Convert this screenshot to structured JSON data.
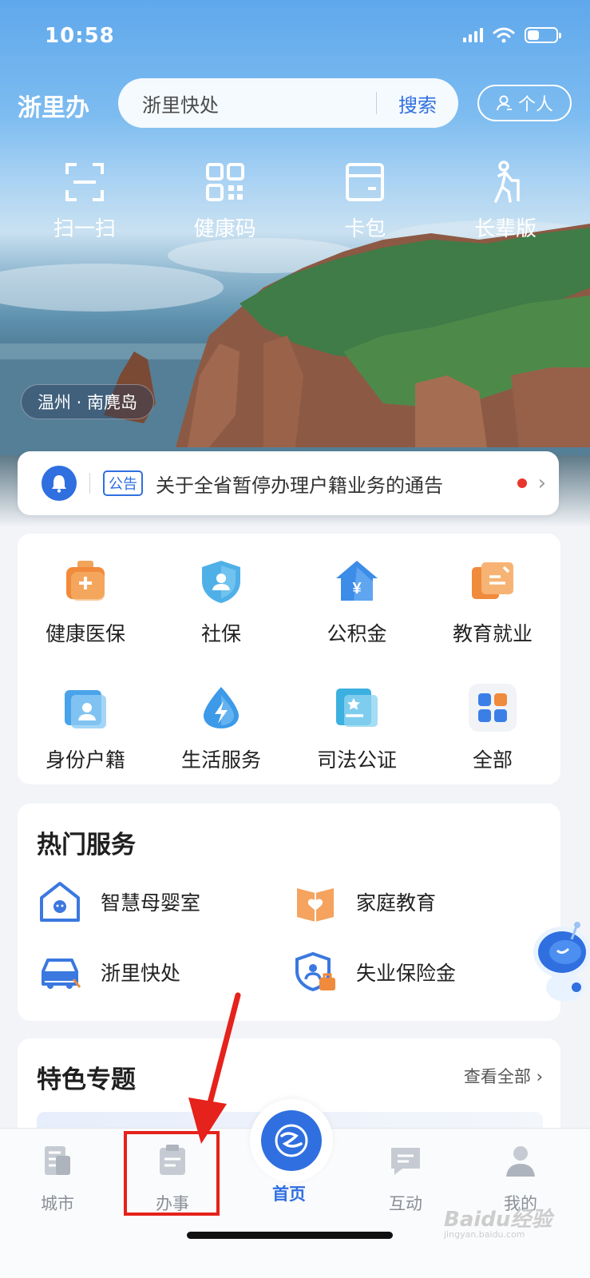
{
  "status": {
    "time": "10:58"
  },
  "header": {
    "brand": "浙里办",
    "search_placeholder": "浙里快处",
    "search_button": "搜索",
    "personal_label": "个人"
  },
  "quick_actions": [
    {
      "label": "扫一扫",
      "icon": "scan-icon"
    },
    {
      "label": "健康码",
      "icon": "qr-code-icon"
    },
    {
      "label": "卡包",
      "icon": "card-wallet-icon"
    },
    {
      "label": "长辈版",
      "icon": "elder-icon"
    }
  ],
  "location": "温州 · 南麂岛",
  "notice": {
    "tag": "公告",
    "text": "关于全省暂停办理户籍业务的通告"
  },
  "services": [
    {
      "label": "健康医保",
      "icon": "medical-kit-icon"
    },
    {
      "label": "社保",
      "icon": "shield-person-icon"
    },
    {
      "label": "公积金",
      "icon": "house-yuan-icon"
    },
    {
      "label": "教育就业",
      "icon": "education-icon"
    },
    {
      "label": "身份户籍",
      "icon": "id-card-icon"
    },
    {
      "label": "生活服务",
      "icon": "drop-bolt-icon"
    },
    {
      "label": "司法公证",
      "icon": "certificate-icon"
    },
    {
      "label": "全部",
      "icon": "grid-all-icon"
    }
  ],
  "hot": {
    "title": "热门服务",
    "items": [
      {
        "label": "智慧母婴室",
        "icon": "baby-room-icon"
      },
      {
        "label": "家庭教育",
        "icon": "family-book-icon"
      },
      {
        "label": "浙里快处",
        "icon": "car-accident-icon"
      },
      {
        "label": "失业保险金",
        "icon": "insurance-icon"
      }
    ]
  },
  "featured": {
    "title": "特色专题",
    "more": "查看全部"
  },
  "tabs": [
    {
      "label": "城市",
      "icon": "city-icon"
    },
    {
      "label": "办事",
      "icon": "affairs-icon"
    },
    {
      "label": "首页",
      "icon": "home-logo-icon"
    },
    {
      "label": "互动",
      "icon": "chat-icon"
    },
    {
      "label": "我的",
      "icon": "profile-icon"
    }
  ],
  "watermark": {
    "text": "Baidu经验",
    "sub": "jingyan.baidu.com"
  },
  "colors": {
    "accent": "#2f6fe0",
    "highlight": "#e5221b"
  }
}
